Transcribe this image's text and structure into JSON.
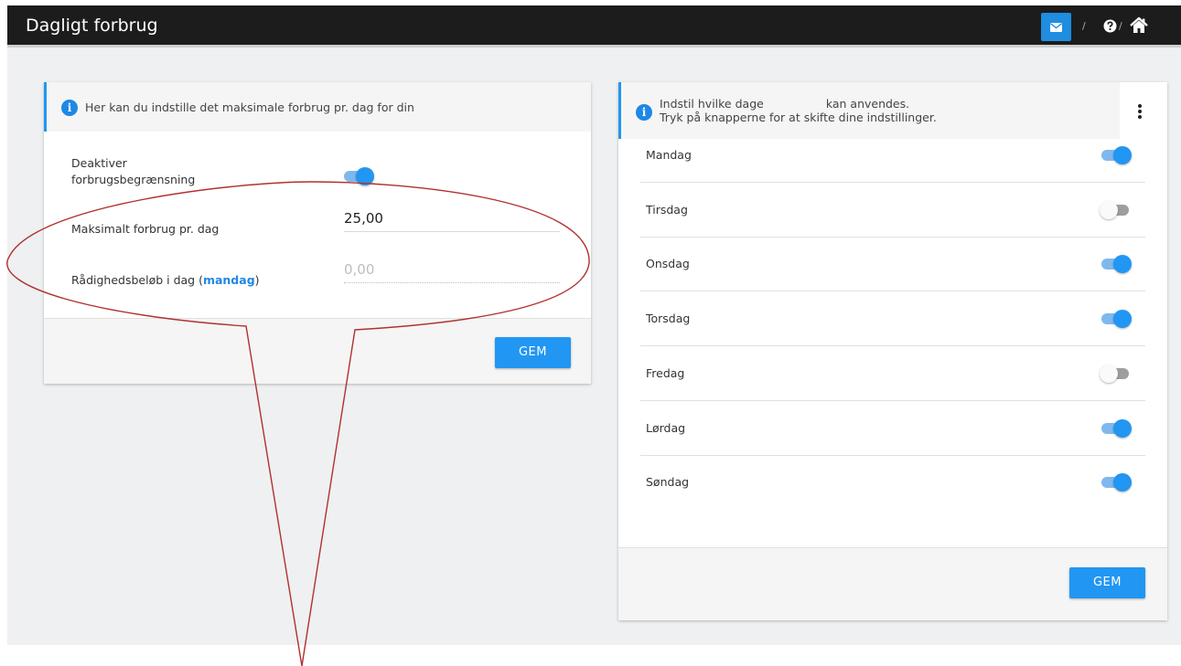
{
  "header": {
    "title": "Dagligt forbrug",
    "sep1": "/",
    "sep2": "/",
    "icons": [
      "envelope-icon",
      "question-circle-icon",
      "home-icon"
    ],
    "mail_button_color": "#1f8de0"
  },
  "left_card": {
    "info": "Her kan du indstille det maksimale forbrug pr. dag for din",
    "deactivate_label_line1": "Deaktiver",
    "deactivate_label_line2": "forbrugsbegrænsning",
    "deactivate_enabled": true,
    "max_label": "Maksimalt forbrug pr. dag",
    "max_value": "25,00",
    "available_label_prefix": "Rådighedsbeløb i dag (",
    "available_label_day": "mandag",
    "available_label_suffix": ")",
    "available_value": "0,00",
    "save_label": "GEM"
  },
  "right_card": {
    "info_line1_part1": "Indstil hvilke dage",
    "info_line1_part2": "kan anvendes.",
    "info_line2": "Tryk på knapperne for at skifte dine indstillinger.",
    "days": [
      {
        "name": "Mandag",
        "on": true
      },
      {
        "name": "Tirsdag",
        "on": false
      },
      {
        "name": "Onsdag",
        "on": true
      },
      {
        "name": "Torsdag",
        "on": true
      },
      {
        "name": "Fredag",
        "on": false
      },
      {
        "name": "Lørdag",
        "on": true
      },
      {
        "name": "Søndag",
        "on": true
      }
    ],
    "save_label": "GEM"
  },
  "colors": {
    "accent": "#2196f3",
    "annotation": "#b03030"
  }
}
